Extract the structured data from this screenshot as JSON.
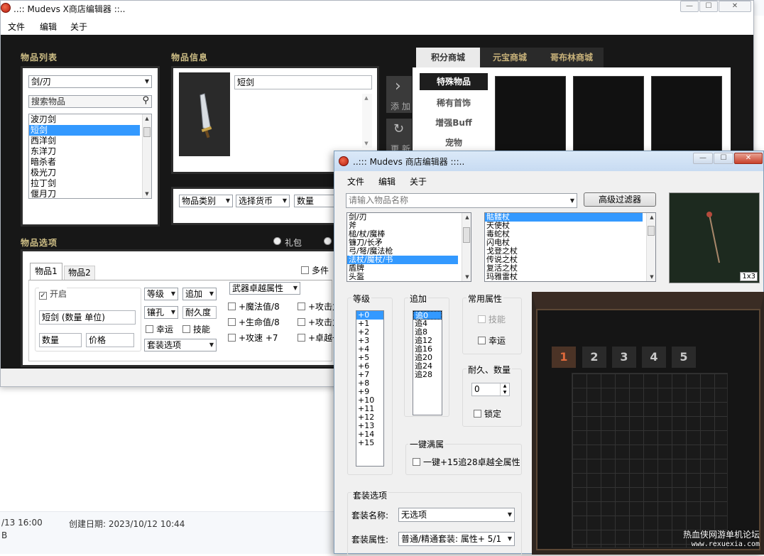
{
  "desktop": {
    "status_modified": "/13 16:00",
    "status_created": "创建日期: 2023/10/12 10:44",
    "status_size": "B",
    "watermark_line1": "热血侠网游单机论坛",
    "watermark_line2": "www.rexuexia.com"
  },
  "w1": {
    "title": "..:: Mudevs X商店编辑器 ::..",
    "menu": [
      "文件",
      "编辑",
      "关于"
    ],
    "controls": [
      "—",
      "☐",
      "✕"
    ],
    "sections": {
      "item_list": "物品列表",
      "item_info": "物品信息",
      "item_options": "物品选项"
    },
    "category": "剑/刃",
    "search_placeholder": "搜索物品",
    "items": [
      "波刃剑",
      "短剑",
      "西洋剑",
      "东洋刀",
      "暗杀者",
      "极光刀",
      "拉丁剑",
      "偃月刀"
    ],
    "info_name": "短剑",
    "add_label": "添 加",
    "refresh_label": "更 新",
    "filters": [
      "物品类别",
      "选择货币",
      "数量"
    ],
    "radio_gift": "礼包",
    "tabs": [
      "物品1",
      "物品2"
    ],
    "multi_label": "多件",
    "enable_label": "开启",
    "item_desc": "短剑 (数量 单位)",
    "qty_label": "数量",
    "price_label": "价格",
    "level_label": "等级",
    "add_opt_label": "追加",
    "socket_label": "镶孔",
    "durability_label": "耐久度",
    "luck_label": "幸运",
    "skill_label": "技能",
    "set_label": "套装选项",
    "excellent_label": "武器卓越属性",
    "excellent_opts": [
      "+魔法值/8",
      "+生命值/8",
      "+攻速 +7"
    ],
    "excellent_opts2": [
      "+攻击力",
      "+攻击力",
      "+卓越一"
    ],
    "shop_tabs": [
      "积分商城",
      "元宝商城",
      "哥布林商城"
    ],
    "shop_side": [
      "特殊物品",
      "稀有首饰",
      "增强Buff",
      "宠物"
    ]
  },
  "w2": {
    "title": "..::: Mudevs 商店编辑器 :::..",
    "menu": [
      "文件",
      "编辑",
      "关于"
    ],
    "search_placeholder": "请输入物品名称",
    "filter_button": "高级过滤器",
    "categories": [
      "剑/刃",
      "斧",
      "槌/杖/魔棒",
      "镰刀/长矛",
      "弓/弩/魔法枪",
      "法杖/魔杖/书",
      "盾牌",
      "头盔"
    ],
    "items": [
      "骷髅杖",
      "天使杖",
      "毒蛇杖",
      "闪电杖",
      "戈登之杖",
      "传说之杖",
      "复活之杖",
      "玛雅雷杖"
    ],
    "preview_size": "1x3",
    "level_title": "等级",
    "levels": [
      "+0",
      "+1",
      "+2",
      "+3",
      "+4",
      "+5",
      "+6",
      "+7",
      "+8",
      "+9",
      "+10",
      "+11",
      "+12",
      "+13",
      "+14",
      "+15"
    ],
    "add_title": "追加",
    "adds": [
      "追0",
      "追4",
      "追8",
      "追12",
      "追16",
      "追20",
      "追24",
      "追28"
    ],
    "common_title": "常用属性",
    "skill_label": "技能",
    "luck_label": "幸运",
    "dur_title": "耐久、数量",
    "dur_value": "0",
    "lock_label": "锁定",
    "full_title": "一键满属",
    "full_label": "一键+15追28卓越全属性",
    "set_section": "套装选项",
    "set_name_label": "套装名称:",
    "set_name_value": "无选项",
    "set_attr_label": "套装属性:",
    "set_attr_value": "普通/精通套装: 属性+ 5/1",
    "inventory_tabs": [
      "1",
      "2",
      "3",
      "4",
      "5"
    ]
  }
}
